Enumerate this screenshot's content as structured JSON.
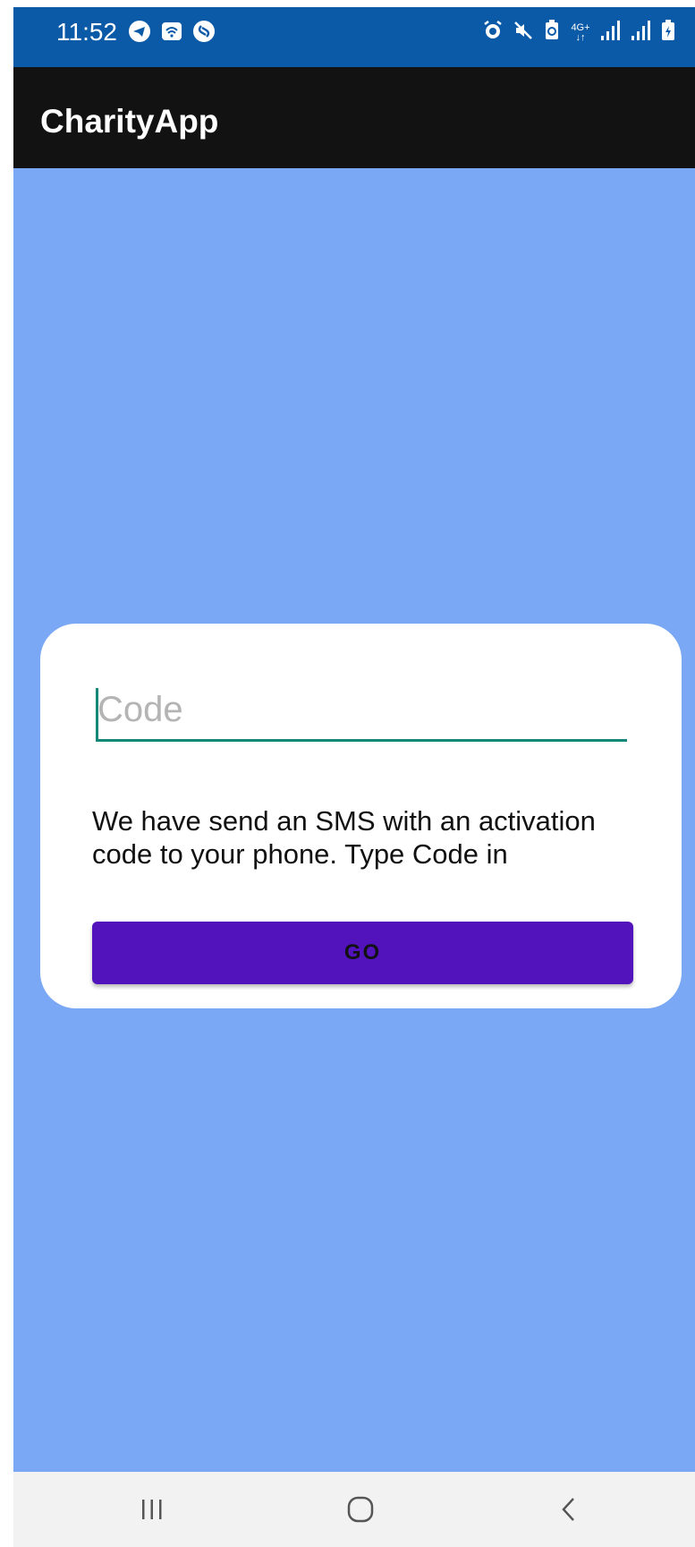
{
  "status_bar": {
    "time": "11:52",
    "left_icons": [
      "telegram-icon",
      "cast-icon",
      "shazam-icon"
    ],
    "right_icons": [
      "alarm-icon",
      "mute-icon",
      "battery-saver-icon",
      "4g-signal-icon",
      "signal-icon",
      "signal-icon",
      "battery-icon"
    ],
    "network_label": "4G+"
  },
  "app_bar": {
    "title": "CharityApp"
  },
  "activation_card": {
    "code_input": {
      "placeholder": "Code",
      "value": ""
    },
    "info_text": "We have send an SMS with an activation code to your phone. Type Code in",
    "go_button_label": "GO"
  },
  "nav_bar": {
    "buttons": [
      "recent-apps-icon",
      "home-icon",
      "back-icon"
    ]
  },
  "colors": {
    "status_bar": "#0b5aa8",
    "app_bar": "#121212",
    "background": "#7aa8f4",
    "accent": "#138878",
    "button": "#5213bd"
  }
}
